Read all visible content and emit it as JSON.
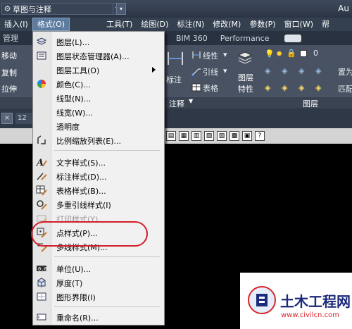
{
  "titlebar": {
    "workspace": "草图与注释",
    "app_title_partial": "Au"
  },
  "menubar": {
    "items": [
      {
        "label": "插入(I)",
        "active": false
      },
      {
        "label": "格式(O)",
        "active": true
      },
      {
        "label": "工具(T)",
        "active": false
      },
      {
        "label": "绘图(D)",
        "active": false
      },
      {
        "label": "标注(N)",
        "active": false
      },
      {
        "label": "修改(M)",
        "active": false
      },
      {
        "label": "参数(P)",
        "active": false
      },
      {
        "label": "窗口(W)",
        "active": false
      },
      {
        "label": "帮",
        "active": false
      }
    ]
  },
  "ribbon": {
    "tabs_left": [
      "管理"
    ],
    "tabs_right": [
      "BIM 360",
      "Performance"
    ],
    "left_tools": [
      "移动",
      "复制",
      "拉伸"
    ],
    "annotation_tools": [
      "标注",
      "线性",
      "引线",
      "表格"
    ],
    "annotation_panel_label": "注释",
    "layer_tool": "图层特性",
    "layer_tool_line1": "图层",
    "layer_tool_line2": "特性",
    "layer_value": "0",
    "layer_panel_label": "图层",
    "right_tools": [
      "置为",
      "匹配"
    ],
    "doc_tab": "12"
  },
  "format_menu": {
    "items": [
      {
        "label": "图层(L)...",
        "icon": "layer-icon",
        "disabled": false,
        "submenu": false
      },
      {
        "label": "图层状态管理器(A)...",
        "icon": "layer-state-icon",
        "disabled": false,
        "submenu": false
      },
      {
        "label": "图层工具(O)",
        "icon": "",
        "disabled": false,
        "submenu": true
      },
      {
        "label": "颜色(C)...",
        "icon": "color-wheel-icon",
        "disabled": false,
        "submenu": false
      },
      {
        "label": "线型(N)...",
        "icon": "",
        "disabled": false,
        "submenu": false
      },
      {
        "label": "线宽(W)...",
        "icon": "",
        "disabled": false,
        "submenu": false
      },
      {
        "label": "透明度",
        "icon": "",
        "disabled": false,
        "submenu": false
      },
      {
        "label": "比例缩放列表(E)...",
        "icon": "scale-list-icon",
        "disabled": false,
        "submenu": false
      },
      {
        "label": "文字样式(S)...",
        "icon": "text-style-icon",
        "disabled": false,
        "submenu": false
      },
      {
        "label": "标注样式(D)...",
        "icon": "dimension-style-icon",
        "disabled": false,
        "submenu": false
      },
      {
        "label": "表格样式(B)...",
        "icon": "table-style-icon",
        "disabled": false,
        "submenu": false
      },
      {
        "label": "多重引线样式(I)",
        "icon": "multileader-style-icon",
        "disabled": false,
        "submenu": false
      },
      {
        "label": "打印样式(Y)...",
        "icon": "plot-style-icon",
        "disabled": true,
        "submenu": false
      },
      {
        "label": "点样式(P)...",
        "icon": "point-style-icon",
        "disabled": false,
        "submenu": false
      },
      {
        "label": "多线样式(M)...",
        "icon": "multiline-style-icon",
        "disabled": false,
        "submenu": false
      },
      {
        "label": "单位(U)...",
        "icon": "units-icon",
        "disabled": false,
        "submenu": false
      },
      {
        "label": "厚度(T)",
        "icon": "thickness-icon",
        "disabled": false,
        "submenu": false
      },
      {
        "label": "图形界限(I)",
        "icon": "drawing-limits-icon",
        "disabled": false,
        "submenu": false
      },
      {
        "label": "重命名(R)...",
        "icon": "rename-icon",
        "disabled": false,
        "submenu": false
      }
    ]
  },
  "watermark": {
    "brand": "土木工程网",
    "url": "www.civilcn.com"
  },
  "colors": {
    "highlight_ring": "#d21f2a",
    "menu_active": "#5d7ca0",
    "watermark_brand": "#1b2a7a",
    "watermark_url": "#d7262d"
  }
}
